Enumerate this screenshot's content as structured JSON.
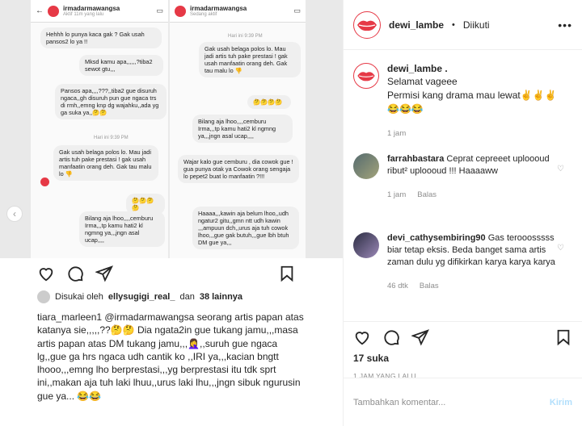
{
  "post": {
    "username": "dewi_lambe",
    "separator": "•",
    "follow_status": "Diikuti",
    "more": "•••",
    "caption_user": "dewi_lambe .",
    "caption_lines": [
      "Selamat vageee",
      "Permisi kang drama mau lewat✌️✌️✌️",
      "😂😂😂"
    ],
    "caption_time": "1 jam"
  },
  "comments": [
    {
      "user": "farrahbastara",
      "text": "Ceprat cepreeet uploooud ribut² uploooud !!! Haaaaww",
      "time": "1 jam",
      "reply": "Balas"
    },
    {
      "user": "devi_cathysembiring90",
      "text": "Gas terooosssss biar tetap eksis. Beda banget sama artis zaman dulu yg difikirkan karya karya karya",
      "time": "46 dtk",
      "reply": "Balas"
    }
  ],
  "footer": {
    "likes": "17 suka",
    "ago": "1 JAM YANG LALU",
    "comment_placeholder": "Tambahkan komentar...",
    "post_label": "Kirim"
  },
  "media": {
    "left_header": {
      "name": "irmadarmawangsa",
      "status": "Aktif 11m yang lalu"
    },
    "right_header": {
      "name": "irmadarmawangsa",
      "status": "Sedang aktif"
    },
    "left_bubbles": [
      "Hehhh lo punya kaca gak ? Gak usah pansos2 lo ya !!",
      "Mksd kamu apa,,,,,,?tiba2 sewot gtu,,,",
      "Pansos apa,,,,???,,tiba2 gue disuruh ngaca,,gh disuruh pun gue ngaca trs di rmh,,emng knp dg wajahku,,ada yg ga suka ya,,🤔🤔",
      "Gak usah belaga polos lo. Mau jadi artis tuh pake prestasi ! gak usah manfaatin orang deh. Gak tau malu lo 👎",
      "🤔🤔🤔🤔",
      "Bilang aja lhoo,,,,cemburu Irma,,,tp kamu hati2 kl ngmng ya,,,jngn asal ucap,,,,"
    ],
    "left_time": "Hari ini 9:39 PM",
    "right_time": "Hari ini 9:39 PM",
    "right_bubbles": [
      "Gak usah belaga polos lo. Mau jadi artis tuh pake prestasi ! gak usah manfaatin orang deh. Gak tau malu lo 👎",
      "🤔🤔🤔🤔",
      "Bilang aja lhoo,,,,cemburu Irma,,,tp kamu hati2 kl ngmng ya,,,jngn asal ucap,,,,",
      "Wajar kalo gue cemburu , dia cowok gue ! gua punya otak ya Cowok orang sengaja lo pepet2 buat lo manfaatin ?!!!",
      "Haaaa,,,kawin aja belum lhoo,,udh ngatur2 gitu,,gmn ntt udh kawin ,,,ampuun dch,,urus aja tuh cowok lhoo,,,gue gak butuh,,,gue lbh btuh DM gue ya,,,"
    ],
    "liked_by": "Disukai oleh",
    "liked_user": "ellysugigi_real_",
    "liked_and": "dan",
    "liked_count": "38 lainnya",
    "caption": "tiara_marleen1 @irmadarmawangsa seorang artis papan atas katanya sie,,,,,??🤔🤔 Dia ngata2in gue tukang jamu,,,masa artis papan atas DM tukang jamu,,,🤦‍♀️,,suruh gue ngaca lg,,gue ga hrs ngaca udh cantik ko ,,IRI ya,,,kacian bngtt lhooo,,,emng lho berprestasi,,,yg berprestasi itu tdk sprt ini,,makan aja tuh laki lhuu,,urus laki lhu,,,jngn sibuk ngurusin gue ya... 😂😂"
  },
  "colors": {
    "brand": "#e63946",
    "link": "#b2dffc",
    "muted": "#8e8e8e"
  },
  "icons": [
    "heart-icon",
    "comment-icon",
    "share-icon",
    "bookmark-icon",
    "more-icon",
    "chevron-left-icon"
  ]
}
